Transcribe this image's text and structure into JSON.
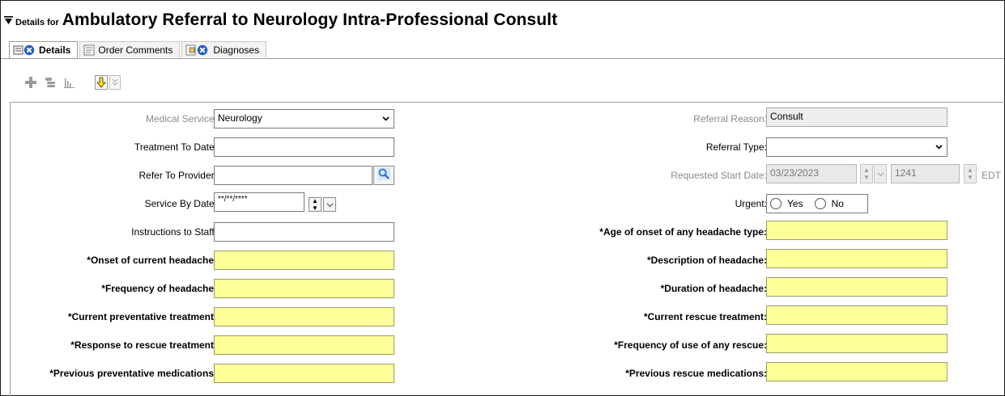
{
  "header": {
    "prefix": "Details for",
    "title": "Ambulatory Referral to Neurology Intra-Professional Consult"
  },
  "tabs": [
    {
      "label": "Details",
      "active": true
    },
    {
      "label": "Order Comments",
      "active": false
    },
    {
      "label": "Diagnoses",
      "active": false
    }
  ],
  "toolbar": {
    "icons": [
      "add-icon",
      "stack-icon",
      "chart-bars-icon",
      "arrow-down-icon",
      "double-chevron-down-icon"
    ]
  },
  "form": {
    "left": {
      "medical_service": {
        "label": "Medical Service:",
        "value": "Neurology"
      },
      "treatment_to_date": {
        "label": "Treatment To Date:",
        "value": ""
      },
      "refer_to_provider": {
        "label": "Refer To Provider:",
        "value": ""
      },
      "service_by_date": {
        "label": "Service By Date:",
        "value": "**/**/****"
      },
      "instructions_to_staff": {
        "label": "Instructions to Staff:",
        "value": ""
      },
      "onset_current_headache": {
        "label": "*Onset of current headache:",
        "value": ""
      },
      "frequency_headache": {
        "label": "*Frequency of headache:",
        "value": ""
      },
      "current_preventative": {
        "label": "*Current preventative treatment:",
        "value": ""
      },
      "response_rescue": {
        "label": "*Response to rescue treatment:",
        "value": ""
      },
      "previous_preventative": {
        "label": "*Previous preventative medications:",
        "value": ""
      }
    },
    "right": {
      "referral_reason": {
        "label": "Referral Reason:",
        "value": "Consult"
      },
      "referral_type": {
        "label": "Referral Type:",
        "value": ""
      },
      "requested_start_date": {
        "label": "Requested Start Date:",
        "date": "03/23/2023",
        "time": "1241",
        "tz": "EDT"
      },
      "urgent": {
        "label": "Urgent:",
        "options": [
          "Yes",
          "No"
        ]
      },
      "age_onset": {
        "label": "*Age of onset of any headache type:",
        "value": ""
      },
      "description_headache": {
        "label": "*Description of headache:",
        "value": ""
      },
      "duration_headache": {
        "label": "*Duration of headache:",
        "value": ""
      },
      "current_rescue": {
        "label": "*Current rescue treatment:",
        "value": ""
      },
      "frequency_rescue": {
        "label": "*Frequency of use of any rescue:",
        "value": ""
      },
      "previous_rescue": {
        "label": "*Previous rescue medications:",
        "value": ""
      }
    }
  },
  "colors": {
    "required_field_bg": "#ffff99",
    "disabled_text": "#8a8a8a",
    "search_blue": "#2f6fd6",
    "diag_x_blue": "#1f5fc4"
  }
}
